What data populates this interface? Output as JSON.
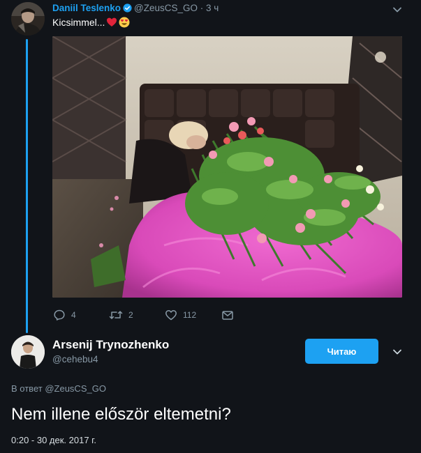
{
  "parent_tweet": {
    "author_name": "Daniil Teslenko",
    "author_handle": "@ZeusCS_GO",
    "separator": "·",
    "time": "3 ч",
    "text": "Kicsimmel...",
    "emojis": [
      "heart-emoji",
      "heart-eyes-emoji"
    ],
    "actions": {
      "reply_count": "4",
      "retweet_count": "2",
      "like_count": "112"
    }
  },
  "reply_tweet": {
    "author_name": "Arsenij Trynozhenko",
    "author_handle": "@cehebu4",
    "follow_label": "Читаю",
    "in_reply_prefix": "В ответ",
    "in_reply_handle": "@ZeusCS_GO",
    "text": "Nem illene először eltemetni?",
    "timestamp": "0:20 - 30 дек. 2017 г."
  },
  "colors": {
    "background": "#111419",
    "accent": "#1da1f2",
    "muted": "#8899a6",
    "text": "#ffffff"
  },
  "icons": [
    "verified-icon",
    "chevron-down-icon",
    "reply-icon",
    "retweet-icon",
    "like-icon",
    "message-icon"
  ]
}
